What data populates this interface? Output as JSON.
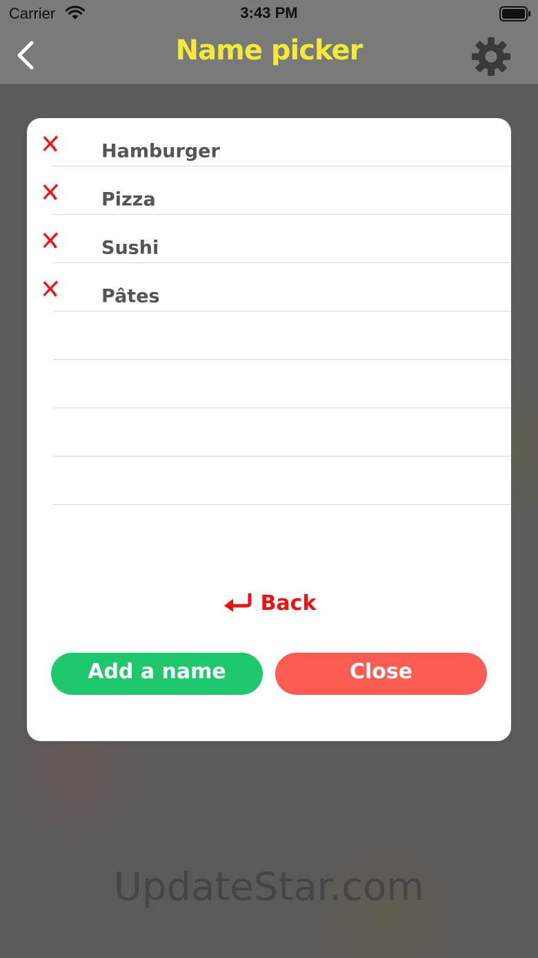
{
  "status_bar": {
    "carrier": "Carrier",
    "time": "3:43 PM"
  },
  "nav": {
    "title": "Name picker",
    "back_icon": "chevron-left-icon",
    "settings_icon": "gear-icon"
  },
  "modal": {
    "names": [
      {
        "label": "Hamburger"
      },
      {
        "label": "Pizza"
      },
      {
        "label": "Sushi"
      },
      {
        "label": "Pâtes"
      },
      {
        "label": ""
      },
      {
        "label": ""
      },
      {
        "label": ""
      },
      {
        "label": ""
      }
    ],
    "back_label": "Back",
    "add_button_label": "Add a name",
    "close_button_label": "Close"
  },
  "colors": {
    "title": "#f2ea3a",
    "add_button": "#1fc76d",
    "close_button": "#fd5c52",
    "remove_icon": "#ee1111",
    "back_link": "#ee1111"
  },
  "watermark": "UpdateStar.com"
}
